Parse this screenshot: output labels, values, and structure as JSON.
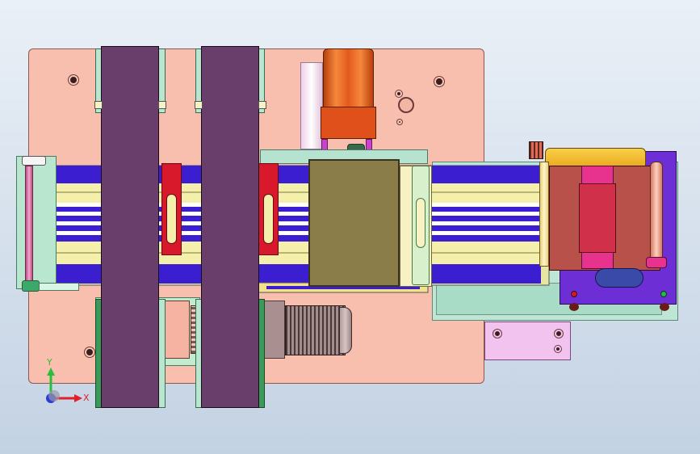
{
  "axis_triad": {
    "y_label": "Y",
    "x_label": "X"
  },
  "colors": {
    "background_top": "#eaf0f7",
    "background_bottom": "#c3d2e3",
    "base_plate": "#f8bfae",
    "belt": "#6a3e6a",
    "conveyor_blue": "#3b1ed0",
    "conveyor_yellow": "#f5efac",
    "motor_gray": "#a48d8d",
    "cylinder_orange": "#e35a1c",
    "cover_olive": "#8b7d4a",
    "clamp_red": "#d8192b",
    "right_module_mint": "#bfe6d4",
    "magenta_part": "#e7338d",
    "gold_part": "#f3b71d",
    "purple_bracket": "#6d2ed6"
  }
}
